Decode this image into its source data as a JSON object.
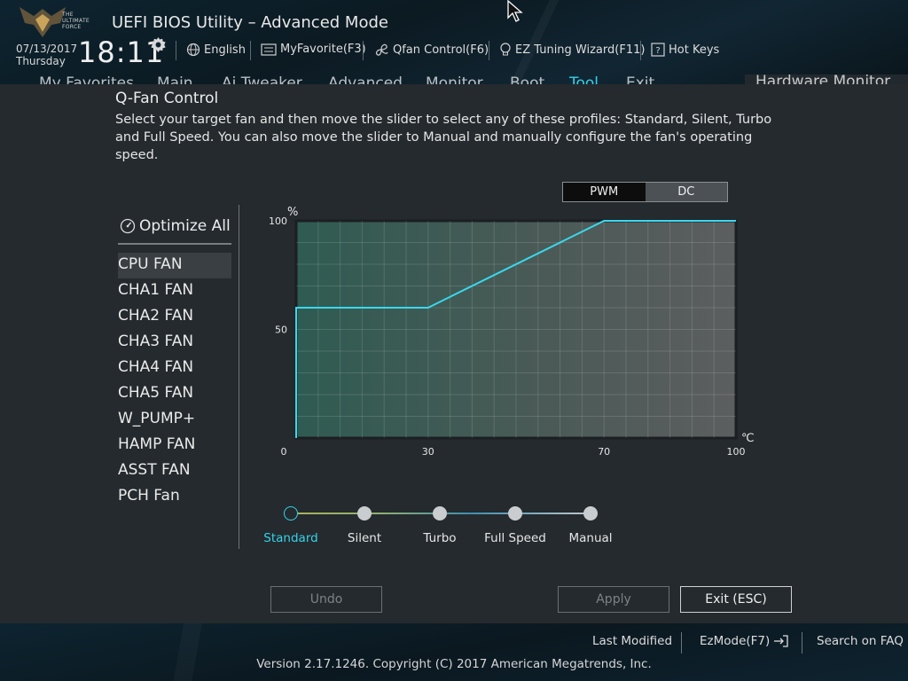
{
  "header": {
    "logo_text": [
      "THE",
      "ULTIMATE",
      "FORCE"
    ],
    "title": "UEFI BIOS Utility – Advanced Mode",
    "date": "07/13/2017",
    "day": "Thursday",
    "time": "18:11",
    "items": [
      {
        "label": "English",
        "icon": "globe-icon"
      },
      {
        "label": "MyFavorite(F3)",
        "icon": "favorite-icon"
      },
      {
        "label": "Qfan Control(F6)",
        "icon": "fan-icon"
      },
      {
        "label": "EZ Tuning Wizard(F11)",
        "icon": "lightbulb-icon"
      },
      {
        "label": "Hot Keys",
        "icon": "help-icon"
      }
    ]
  },
  "menu": {
    "tabs": [
      "My Favorites",
      "Main",
      "Ai Tweaker",
      "Advanced",
      "Monitor",
      "Boot",
      "Tool",
      "Exit"
    ],
    "active": "Tool",
    "hardware_monitor": "Hardware Monitor"
  },
  "dialog": {
    "title": "Q-Fan Control",
    "description": "Select your target fan and then move the slider to select any of these profiles: Standard, Silent, Turbo and Full Speed. You can also move the slider to Manual and manually configure the fan's operating speed.",
    "optimize_all": "Optimize All",
    "fans": [
      "CPU FAN",
      "CHA1 FAN",
      "CHA2 FAN",
      "CHA3 FAN",
      "CHA4 FAN",
      "CHA5 FAN",
      "W_PUMP+",
      "HAMP FAN",
      "ASST FAN",
      "PCH Fan"
    ],
    "selected_fan": "CPU FAN",
    "mode_options": [
      "PWM",
      "DC"
    ],
    "selected_mode": "PWM",
    "profiles": [
      "Standard",
      "Silent",
      "Turbo",
      "Full Speed",
      "Manual"
    ],
    "selected_profile": "Standard",
    "buttons": {
      "undo": "Undo",
      "apply": "Apply",
      "exit": "Exit (ESC)"
    }
  },
  "chart_data": {
    "type": "line",
    "xlabel": "℃",
    "ylabel": "%",
    "xlim": [
      0,
      100
    ],
    "ylim": [
      0,
      100
    ],
    "xticks": [
      "0",
      "30",
      "70",
      "100"
    ],
    "yticks": [
      "50",
      "100"
    ],
    "grid": true,
    "series": [
      {
        "x": [
          0,
          0,
          30,
          70,
          100
        ],
        "y": [
          0,
          60,
          60,
          100,
          100
        ]
      }
    ],
    "line_color": "#3ad8ee"
  },
  "footer": {
    "last_modified": "Last Modified",
    "ezmode": "EzMode(F7)",
    "search_faq": "Search on FAQ",
    "copyright": "Version 2.17.1246. Copyright (C) 2017 American Megatrends, Inc."
  },
  "colors": {
    "accent": "#33d3ea",
    "background": "#252a2e"
  }
}
